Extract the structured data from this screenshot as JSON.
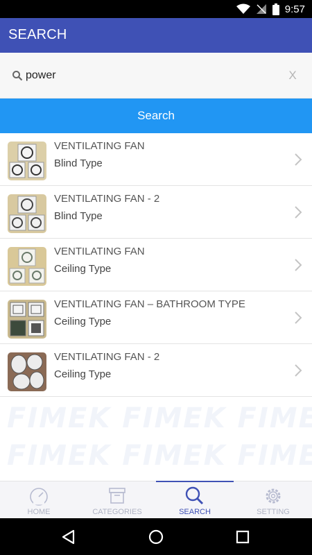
{
  "status_bar": {
    "time": "9:57"
  },
  "app_bar": {
    "title": "SEARCH"
  },
  "search": {
    "value": "power",
    "clear_label": "X",
    "button_label": "Search"
  },
  "results": [
    {
      "title": "VENTILATING FAN",
      "subtitle": "Blind Type",
      "thumb_bg": "#dccfa8"
    },
    {
      "title": "VENTILATING FAN - 2",
      "subtitle": "Blind Type",
      "thumb_bg": "#d8c9a0"
    },
    {
      "title": "VENTILATING FAN",
      "subtitle": "Ceiling Type",
      "thumb_bg": "#d9c898"
    },
    {
      "title": "VENTILATING FAN – BATHROOM TYPE",
      "subtitle": "Ceiling Type",
      "thumb_bg": "#c9b98e"
    },
    {
      "title": "VENTILATING FAN - 2",
      "subtitle": "Ceiling Type",
      "thumb_bg": "#8a6a55"
    }
  ],
  "watermark": {
    "text": "FIMEK  FIMEK  FIMEK  FIMEK"
  },
  "bottom_nav": [
    {
      "label": "HOME",
      "icon": "speedometer-icon",
      "active": false
    },
    {
      "label": "CATEGORIES",
      "icon": "archive-box-icon",
      "active": false
    },
    {
      "label": "SEARCH",
      "icon": "search-icon",
      "active": true
    },
    {
      "label": "SETTING",
      "icon": "gear-icon",
      "active": false
    }
  ],
  "colors": {
    "primary": "#3f51b5",
    "accent": "#2196f3",
    "inactive": "#b0b4c4"
  }
}
